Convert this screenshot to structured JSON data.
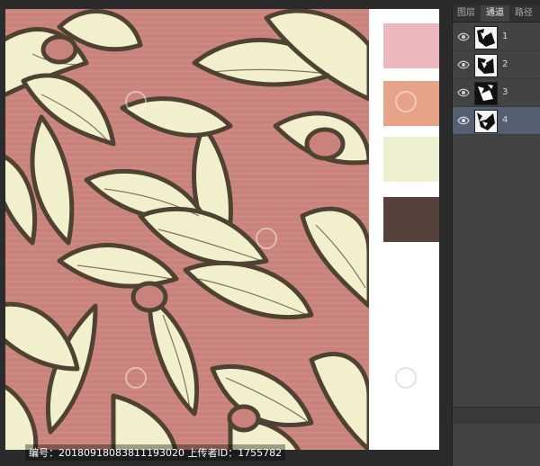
{
  "canvas": {
    "background": "#ffffff",
    "pattern_colors": {
      "ground": "#c9837c",
      "petal": "#f2f0cc",
      "outline": "#4e4233"
    }
  },
  "swatches": [
    {
      "name": "pink",
      "color": "#ebb8bd"
    },
    {
      "name": "salmon",
      "color": "#e6a386"
    },
    {
      "name": "cream",
      "color": "#eeeed0"
    },
    {
      "name": "brown",
      "color": "#56423a"
    }
  ],
  "watermark": {
    "text": "编号：20180918083811193020 上传者ID：1755782"
  },
  "panel": {
    "tabs": [
      {
        "label": "图层",
        "active": false
      },
      {
        "label": "通道",
        "active": true
      },
      {
        "label": "路径",
        "active": false
      }
    ],
    "channels": [
      {
        "label": "1",
        "visible": true,
        "selected": false
      },
      {
        "label": "2",
        "visible": true,
        "selected": false
      },
      {
        "label": "3",
        "visible": true,
        "selected": false
      },
      {
        "label": "4",
        "visible": true,
        "selected": true
      }
    ]
  }
}
